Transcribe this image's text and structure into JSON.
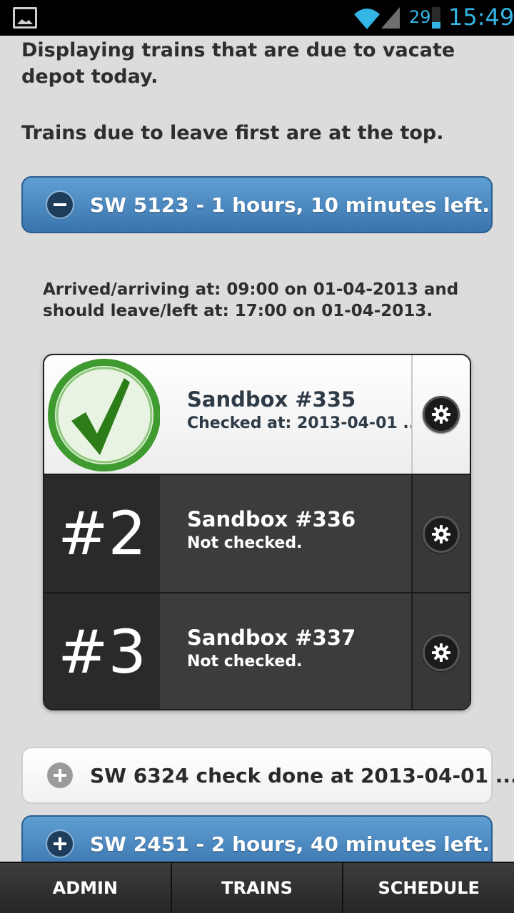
{
  "status_bar": {
    "battery_level": "29",
    "time": "15:49"
  },
  "intro": {
    "line1": "Displaying trains that are due to vacate depot today.",
    "line2": "Trains due to leave first are at the top."
  },
  "trains": [
    {
      "title": "SW 5123 - 1 hours, 10 minutes left.",
      "expanded": true,
      "icon": "minus-icon",
      "arrival_text": "Arrived/arriving at: 09:00 on 01-04-2013 and should leave/left at: 17:00 on 01-04-2013.",
      "checks": [
        {
          "thumb": "checkmark-icon",
          "title": "Sandbox #335",
          "subtitle": "Checked at: 2013-04-01 ..."
        },
        {
          "thumb": "#2",
          "title": "Sandbox #336",
          "subtitle": "Not checked."
        },
        {
          "thumb": "#3",
          "title": "Sandbox #337",
          "subtitle": "Not checked."
        }
      ]
    },
    {
      "title": "SW 6324 check done at 2013-04-01 ...",
      "expanded": false,
      "icon": "plus-icon"
    },
    {
      "title": "SW 2451 - 2 hours, 40 minutes left.",
      "expanded": false,
      "icon": "plus-icon"
    }
  ],
  "nav": {
    "admin": "ADMIN",
    "trains": "TRAINS",
    "schedule": "SCHEDULE"
  },
  "colors": {
    "accent_blue": "#3a74ad",
    "status_blue": "#33b5e5",
    "check_green": "#3f9a2f"
  }
}
